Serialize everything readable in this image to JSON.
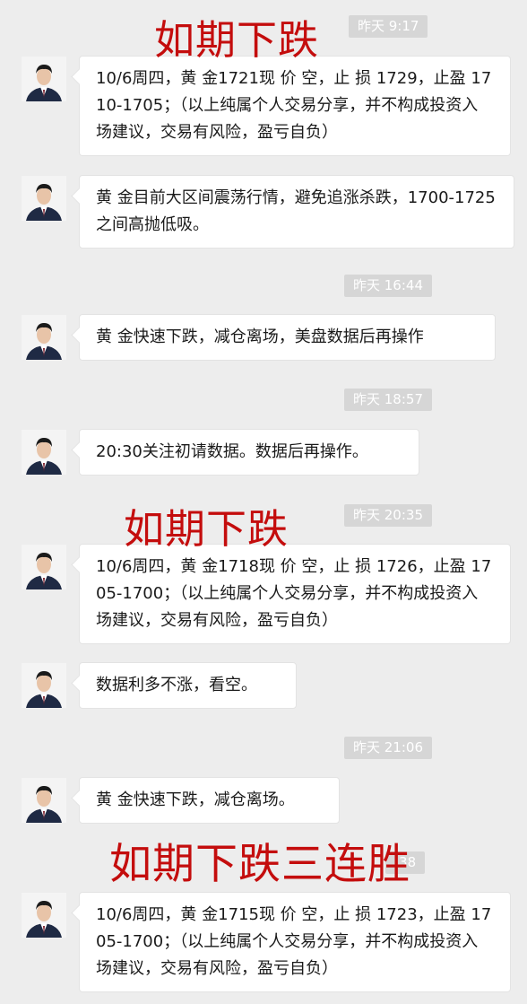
{
  "timestamps": [
    "昨天 9:17",
    "昨天 16:44",
    "昨天 18:57",
    "昨天 20:35",
    "昨天 21:06",
    ":38"
  ],
  "overlays": [
    "如期下跌",
    "如期下跌",
    "如期下跌三连胜"
  ],
  "messages": [
    "10/6周四，黄 金1721现 价 空，止 损 1729，止盈 1710-1705；（以上纯属个人交易分享，并不构成投资入场建议，交易有风险，盈亏自负）",
    "黄 金目前大区间震荡行情，避免追涨杀跌，1700-1725之间高抛低吸。",
    "黄 金快速下跌，减仓离场，美盘数据后再操作",
    "20:30关注初请数据。数据后再操作。",
    "10/6周四，黄 金1718现 价 空，止 损 1726，止盈 1705-1700；（以上纯属个人交易分享，并不构成投资入场建议，交易有风险，盈亏自负）",
    "数据利多不涨，看空。",
    "黄 金快速下跌，减仓离场。",
    "10/6周四，黄 金1715现 价 空，止 损 1723，止盈 1705-1700；（以上纯属个人交易分享，并不构成投资入场建议，交易有风险，盈亏自负）"
  ],
  "colors": {
    "background": "#ededed",
    "bubble": "#ffffff",
    "timestamp_bg": "#d6d6d6",
    "overlay_red": "#c40d0d"
  }
}
